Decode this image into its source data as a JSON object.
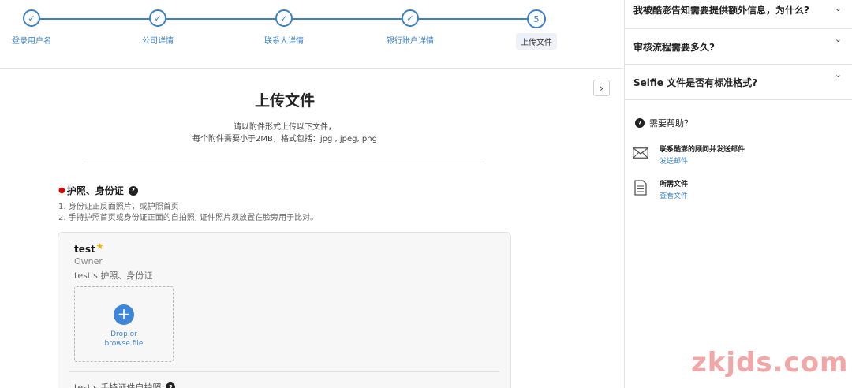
{
  "stepper": {
    "steps": [
      {
        "label": "登录用户名",
        "symbol": "✓"
      },
      {
        "label": "公司详情",
        "symbol": "✓"
      },
      {
        "label": "联系人详情",
        "symbol": "✓"
      },
      {
        "label": "银行账户详情",
        "symbol": "✓"
      },
      {
        "label": "上传文件",
        "symbol": "5"
      }
    ]
  },
  "main": {
    "title": "上传文件",
    "subtitle_1": "请以附件形式上传以下文件，",
    "subtitle_2": "每个附件需要小于2MB，格式包括：jpg , jpeg, png",
    "section_title": "护照、身份证",
    "requirements": [
      "1. 身份证正反面照片，或护照首页",
      "2. 手持护照首页或身份证正面的自拍照, 证件照片须放置在脸旁用于比对。"
    ],
    "card": {
      "name": "test",
      "role": "Owner",
      "doc_label": "test's 护照、身份证",
      "drop_text_1": "Drop or",
      "drop_text_2": "browse file",
      "next_doc_label": "test's 手持证件自拍照"
    }
  },
  "sidebar": {
    "faqs": [
      {
        "question": "我被酷澎告知需要提供额外信息，为什么?"
      },
      {
        "question": "审核流程需要多久?"
      },
      {
        "question": "Selfie 文件是否有标准格式?"
      }
    ],
    "need_help": "需要帮助？",
    "contacts": [
      {
        "title": "联系酷澎的顾问并发送邮件",
        "link": "发送邮件",
        "icon": "mail-icon"
      },
      {
        "title": "所需文件",
        "link": "查看文件",
        "icon": "document-icon"
      }
    ]
  },
  "watermark": "zkjds.com",
  "colors": {
    "accent": "#3b82c4",
    "star": "#f3b200",
    "required": "#e00000"
  }
}
